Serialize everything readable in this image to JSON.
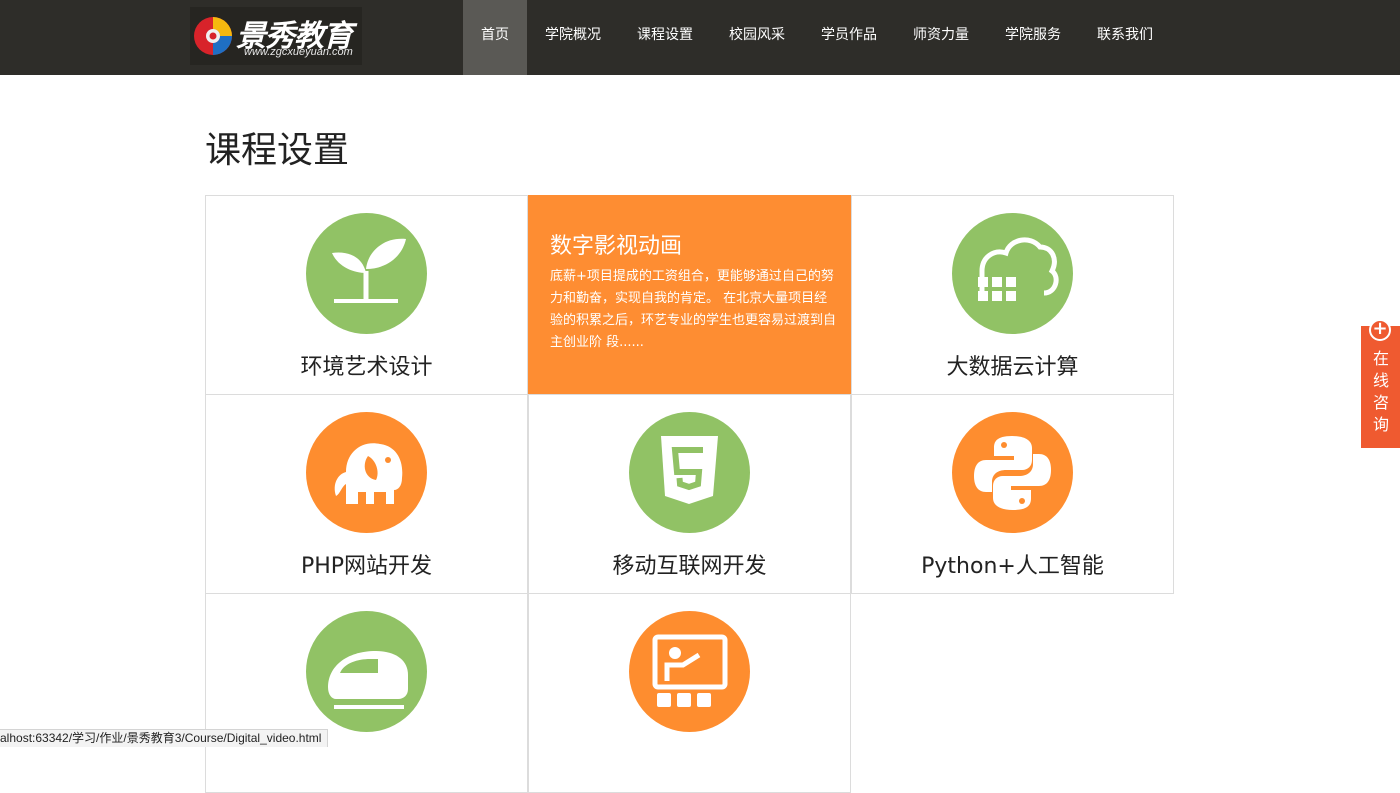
{
  "header": {
    "logo_title": "景秀教育",
    "logo_url": "www.zgcxueyuan.com",
    "nav": [
      "首页",
      "学院概况",
      "课程设置",
      "校园风采",
      "学员作品",
      "师资力量",
      "学院服务",
      "联系我们"
    ],
    "active_nav": "首页"
  },
  "main": {
    "title": "课程设置",
    "courses": [
      {
        "label": "环境艺术设计",
        "icon": "sprout-icon",
        "color": "#91c265"
      },
      {
        "label": "数字影视动画",
        "hover_title": "数字影视动画",
        "description": "底薪+项目提成的工资组合，更能够通过自己的努力和勤奋，实现自我的肯定。 在北京大量项目经验的积累之后，环艺专业的学生也更容易过渡到自主创业阶 段......"
      },
      {
        "label": "大数据云计算",
        "icon": "cloud-data-icon",
        "color": "#91c265"
      },
      {
        "label": "PHP网站开发",
        "icon": "elephant-icon",
        "color": "#fe8d2f"
      },
      {
        "label": "移动互联网开发",
        "icon": "html5-icon",
        "color": "#91c265"
      },
      {
        "label": "Python+人工智能",
        "icon": "python-icon",
        "color": "#fe8d2f"
      },
      {
        "label": "",
        "icon": "train-icon",
        "color": "#91c265"
      },
      {
        "label": "",
        "icon": "teacher-icon",
        "color": "#fe8d2f"
      }
    ]
  },
  "side": {
    "consult_label": "在线咨询",
    "plus": "+"
  },
  "status_url": "alhost:63342/学习/作业/景秀教育3/Course/Digital_video.html"
}
